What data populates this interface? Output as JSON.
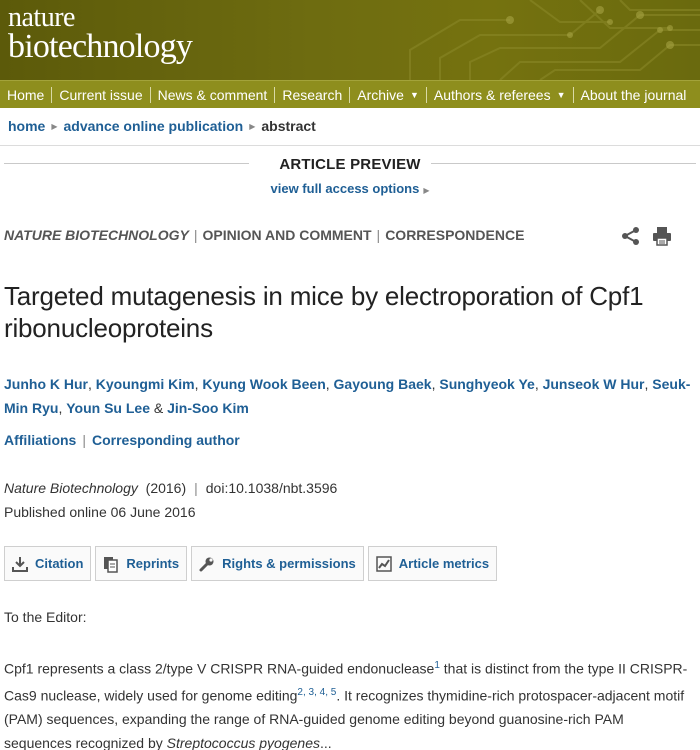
{
  "masthead": {
    "logo_line1": "nature",
    "logo_line2": "biotechnology",
    "accent_color": "#6e6c10",
    "nav_color": "#8e8e1d"
  },
  "nav": {
    "items": [
      {
        "label": "Home",
        "dropdown": false
      },
      {
        "label": "Current issue",
        "dropdown": false
      },
      {
        "label": "News & comment",
        "dropdown": false
      },
      {
        "label": "Research",
        "dropdown": false
      },
      {
        "label": "Archive",
        "dropdown": true
      },
      {
        "label": "Authors & referees",
        "dropdown": true
      },
      {
        "label": "About the journal",
        "dropdown": false
      }
    ],
    "dropdown_icon": "chevron-down-icon"
  },
  "breadcrumb": {
    "home": "home",
    "section": "advance online publication",
    "current": "abstract"
  },
  "preview": {
    "title": "ARTICLE PREVIEW",
    "access_link": "view full access options"
  },
  "article": {
    "journal": "NATURE BIOTECHNOLOGY",
    "category": "OPINION AND COMMENT",
    "type": "CORRESPONDENCE",
    "title": "Targeted mutagenesis in mice by electroporation of Cpf1 ribonucleoproteins",
    "authors": [
      "Junho K Hur",
      "Kyoungmi Kim",
      "Kyung Wook Been",
      "Gayoung Baek",
      "Sunghyeok Ye",
      "Junseok W Hur",
      "Seuk-Min Ryu",
      "Youn Su Lee",
      "Jin-Soo Kim"
    ],
    "affiliations_link": "Affiliations",
    "corresponding_link": "Corresponding author",
    "citation_journal": "Nature Biotechnology",
    "year": "(2016)",
    "doi": "doi:10.1038/nbt.3596",
    "published": "Published online  06 June 2016"
  },
  "actions": [
    {
      "label": "Citation",
      "icon": "download-icon"
    },
    {
      "label": "Reprints",
      "icon": "reprints-icon"
    },
    {
      "label": "Rights & permissions",
      "icon": "wrench-icon"
    },
    {
      "label": "Article metrics",
      "icon": "metrics-icon"
    }
  ],
  "body": {
    "salutation": "To the Editor:",
    "p1_a": "Cpf1 represents a class 2/type V CRISPR RNA-guided endonuclease",
    "ref1": "1",
    "p1_b": " that is distinct from the type II CRISPR-Cas9 nuclease, widely used for genome editing",
    "refs2": "2, 3, 4, 5",
    "p1_c": ". It recognizes thymidine-rich protospacer-adjacent motif (PAM) sequences, expanding the range of RNA-guided genome editing beyond guanosine-rich PAM sequences recognized by ",
    "species": "Streptococcus pyogenes",
    "p1_d": "..."
  },
  "icons": {
    "share": "share-icon",
    "print": "print-icon"
  }
}
